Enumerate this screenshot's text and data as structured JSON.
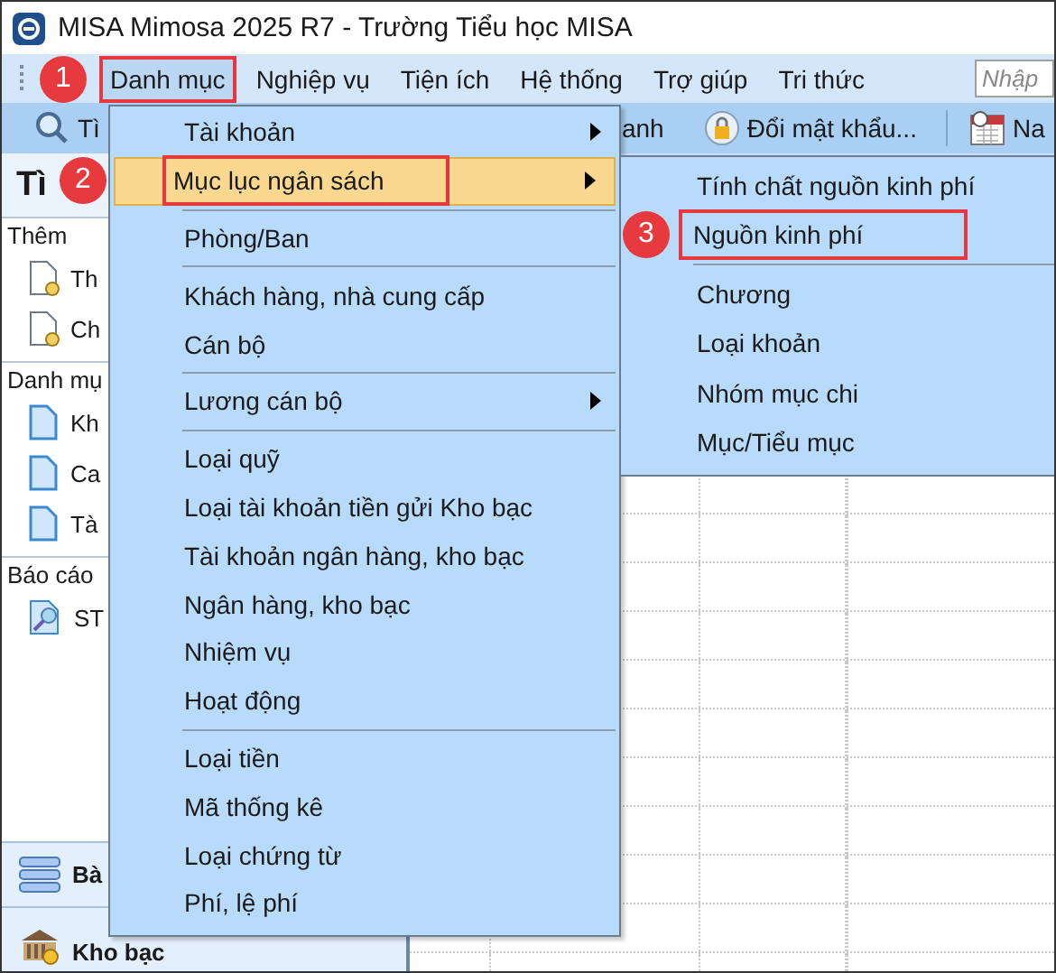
{
  "window": {
    "title": "MISA Mimosa 2025 R7 - Trường Tiểu học MISA"
  },
  "menu_bar": {
    "items": [
      {
        "label": "Danh mục",
        "selected": true,
        "callout": "1"
      },
      {
        "label": "Nghiệp vụ",
        "selected": false
      },
      {
        "label": "Tiện ích",
        "selected": false
      },
      {
        "label": "Hệ thống",
        "selected": false
      },
      {
        "label": "Trợ giúp",
        "selected": false
      },
      {
        "label": "Tri thức",
        "selected": false
      }
    ],
    "search": {
      "placeholder": "Nhập"
    }
  },
  "toolbar": {
    "items": [
      {
        "kind": "search",
        "label": "Tì"
      },
      {
        "kind": "text",
        "label": "anh"
      },
      {
        "kind": "lock",
        "label": "Đổi mật khẩu..."
      },
      {
        "kind": "calendar",
        "label": "Na"
      }
    ]
  },
  "left_panel": {
    "title": "Tì",
    "sections": [
      {
        "title": "Thêm",
        "items": [
          {
            "kind": "new-doc",
            "label": "Th"
          },
          {
            "kind": "new-doc",
            "label": "Ch"
          }
        ]
      },
      {
        "title": "Danh mụ",
        "items": [
          {
            "kind": "doc",
            "label": "Kh"
          },
          {
            "kind": "doc",
            "label": "Ca"
          },
          {
            "kind": "doc",
            "label": "Tà"
          }
        ]
      },
      {
        "title": "Báo cáo",
        "items": [
          {
            "kind": "report",
            "label": "ST"
          }
        ]
      }
    ],
    "nav": [
      {
        "kind": "stack",
        "label": "Bà"
      },
      {
        "kind": "bank",
        "label": "Kho bạc"
      }
    ]
  },
  "dropdown": {
    "groups": [
      [
        {
          "label": "Tài khoản",
          "has_submenu": true,
          "selected": false
        },
        {
          "label": "Mục lục ngân sách",
          "has_submenu": true,
          "selected": true,
          "callout": "2"
        }
      ],
      [
        {
          "label": "Phòng/Ban",
          "has_submenu": false,
          "selected": false
        }
      ],
      [
        {
          "label": "Khách hàng, nhà cung cấp",
          "has_submenu": false,
          "selected": false
        },
        {
          "label": "Cán bộ",
          "has_submenu": false,
          "selected": false
        }
      ],
      [
        {
          "label": "Lương cán bộ",
          "has_submenu": true,
          "selected": false
        }
      ],
      [
        {
          "label": "Loại quỹ",
          "has_submenu": false,
          "selected": false
        },
        {
          "label": "Loại tài khoản tiền gửi Kho bạc",
          "has_submenu": false,
          "selected": false
        },
        {
          "label": "Tài khoản ngân hàng, kho bạc",
          "has_submenu": false,
          "selected": false
        },
        {
          "label": "Ngân hàng, kho bạc",
          "has_submenu": false,
          "selected": false
        },
        {
          "label": "Nhiệm vụ",
          "has_submenu": false,
          "selected": false
        },
        {
          "label": "Hoạt động",
          "has_submenu": false,
          "selected": false
        }
      ],
      [
        {
          "label": "Loại tiền",
          "has_submenu": false,
          "selected": false
        },
        {
          "label": "Mã thống kê",
          "has_submenu": false,
          "selected": false
        },
        {
          "label": "Loại chứng từ",
          "has_submenu": false,
          "selected": false
        },
        {
          "label": "Phí, lệ phí",
          "has_submenu": false,
          "selected": false
        }
      ]
    ]
  },
  "submenu": {
    "groups": [
      [
        {
          "label": "Tính chất nguồn kinh phí"
        },
        {
          "label": "Nguồn kinh phí",
          "callout": "3"
        }
      ],
      [
        {
          "label": "Chương"
        },
        {
          "label": "Loại khoản"
        },
        {
          "label": "Nhóm mục chi"
        },
        {
          "label": "Mục/Tiểu mục"
        }
      ]
    ]
  }
}
